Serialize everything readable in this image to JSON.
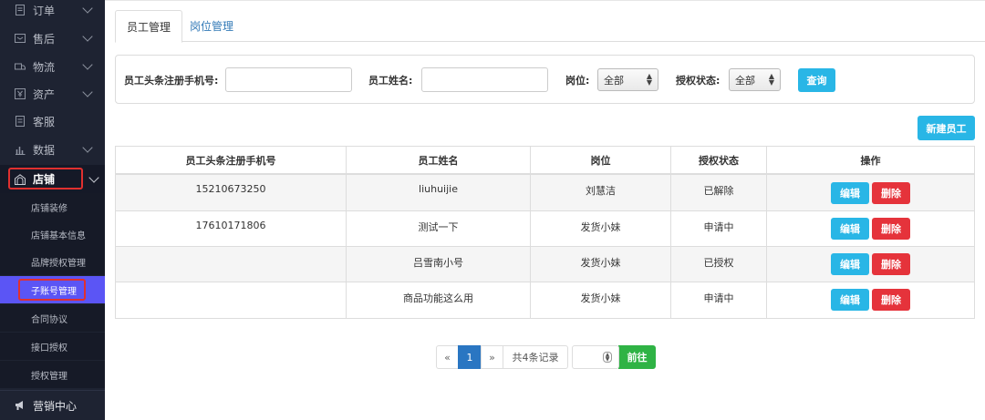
{
  "sidebar": {
    "items": [
      {
        "label": "订单",
        "icon": "order-icon",
        "has_chevron": true
      },
      {
        "label": "售后",
        "icon": "after-sales-icon",
        "has_chevron": true
      },
      {
        "label": "物流",
        "icon": "logistics-icon",
        "has_chevron": true
      },
      {
        "label": "资产",
        "icon": "assets-icon",
        "has_chevron": true
      },
      {
        "label": "客服",
        "icon": "customer-service-icon",
        "has_chevron": false
      },
      {
        "label": "数据",
        "icon": "data-chart-icon",
        "has_chevron": true
      },
      {
        "label": "店铺",
        "icon": "store-icon",
        "has_chevron": true,
        "expanded": true
      }
    ],
    "store_sub_items": [
      {
        "label": "店铺装修"
      },
      {
        "label": "店铺基本信息"
      },
      {
        "label": "品牌授权管理"
      },
      {
        "label": "子账号管理",
        "selected": true
      },
      {
        "label": "合同协议"
      },
      {
        "label": "接口授权"
      },
      {
        "label": "授权管理"
      }
    ],
    "bottom_item": {
      "label": "营销中心",
      "icon": "megaphone-icon"
    }
  },
  "tabs": [
    {
      "label": "员工管理",
      "active": true
    },
    {
      "label": "岗位管理",
      "active": false
    }
  ],
  "filter": {
    "phone_label": "员工头条注册手机号:",
    "phone_value": "",
    "name_label": "员工姓名:",
    "name_value": "",
    "position_label": "岗位:",
    "position_selected": "全部",
    "auth_label": "授权状态:",
    "auth_selected": "全部",
    "search_button": "查询"
  },
  "new_employee_button": "新建员工",
  "table": {
    "headers": [
      "员工头条注册手机号",
      "员工姓名",
      "岗位",
      "授权状态",
      "操作"
    ],
    "rows": [
      {
        "phone": "15210673250",
        "name": "liuhuijie",
        "position": "刘慧洁",
        "status": "已解除"
      },
      {
        "phone": "17610171806",
        "name": "测试一下",
        "position": "发货小妹",
        "status": "申请中"
      },
      {
        "phone": "",
        "name": "吕雪南小号",
        "position": "发货小妹",
        "status": "已授权"
      },
      {
        "phone": "",
        "name": "商品功能这么用",
        "position": "发货小妹",
        "status": "申请中"
      }
    ],
    "edit_label": "编辑",
    "delete_label": "删除"
  },
  "pagination": {
    "prev": "«",
    "current_page": "1",
    "next": "»",
    "total_text": "共4条记录",
    "goto_value": "",
    "goto_button": "前往"
  },
  "colors": {
    "sidebar_bg": "#1e2332",
    "selected_sub_item": "#5b55f5",
    "highlight_box": "#e0302f",
    "info_button": "#29b6e6",
    "danger_button": "#e5333b",
    "success_button": "#2fb345",
    "page_active": "#2a76c2"
  }
}
